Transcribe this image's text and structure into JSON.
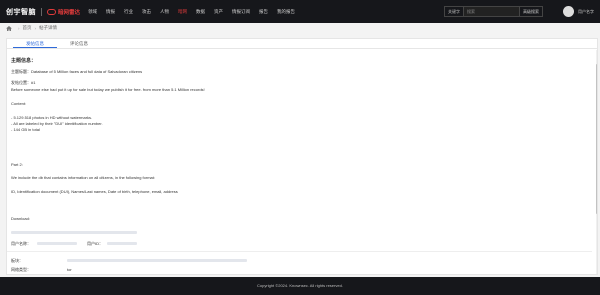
{
  "header": {
    "logo": "创宇智脑",
    "brand": "暗网雷达",
    "nav": [
      "领域",
      "情报",
      "行业",
      "攻击",
      "人物",
      "暗网",
      "数据",
      "资产",
      "情报订阅",
      "报告",
      "我的报告"
    ],
    "active_nav_index": 5,
    "search_type": "关键字",
    "search_placeholder": "搜索",
    "search_button": "高级搜索",
    "user_name": "用户名字"
  },
  "breadcrumb": {
    "items": [
      "首页",
      "帖子详情"
    ]
  },
  "tabs": [
    "发帖信息",
    "评论信息"
  ],
  "active_tab_index": 0,
  "post": {
    "section_title": "主题信息：",
    "subject_label": "主题标题：",
    "subject": "Database of 5 Million faces and full data of Salvadoran citizens",
    "floor_label": "发帖位置：",
    "floor": "#1",
    "intro": "Before someone else had put it up for sale but today we publish it for free. from more than 5.1 Million records!",
    "content_label": "Content:",
    "bullets": [
      "- 5.129.518 photos in HD without watermarks.",
      "- All are labeled by their \"DUI\" identification number.",
      "- 144 GB in total"
    ],
    "part2_label": "Part 2:",
    "part2_text": "We include the db that contains information on all citizens, in the following format:",
    "part2_fields": "ID, Identification document (DUI), Names/Last names, Date of birth, telephone, email, address",
    "download_label": "Download:",
    "poster_label": "用户名称：",
    "poster_id_label": "用户ID：",
    "board_label": "板块：",
    "site_type_label": "网络类型：",
    "site_type": "tor"
  },
  "footer": {
    "copyright": "Copyright ©2024. Knownsec. All rights reserved."
  }
}
